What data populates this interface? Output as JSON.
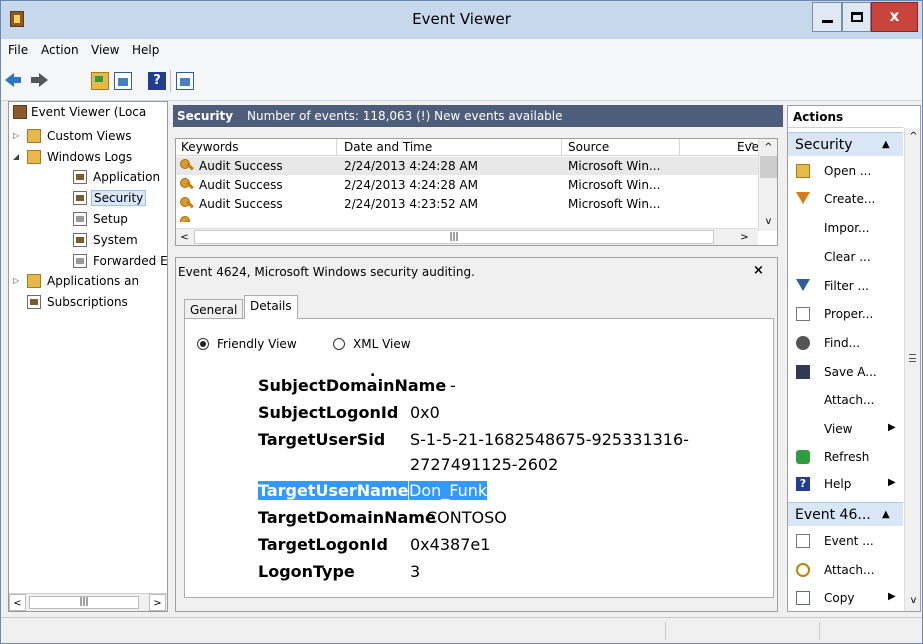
{
  "window": {
    "title": "Event Viewer"
  },
  "menu": [
    "File",
    "Action",
    "View",
    "Help"
  ],
  "tree": {
    "root": "Event Viewer (Loca",
    "custom_views": "Custom Views",
    "windows_logs": "Windows Logs",
    "application": "Application",
    "security": "Security",
    "setup": "Setup",
    "system": "System",
    "forwarded": "Forwarded E",
    "apps_services": "Applications an",
    "subscriptions": "Subscriptions"
  },
  "log_header": {
    "title": "Security",
    "info": "Number of events: 118,063 (!) New events available"
  },
  "events": {
    "columns": [
      "Keywords",
      "Date and Time",
      "Source",
      "Eve"
    ],
    "rows": [
      {
        "keywords": "Audit Success",
        "date": "2/24/2013 4:24:28 AM",
        "source": "Microsoft Win..."
      },
      {
        "keywords": "Audit Success",
        "date": "2/24/2013 4:24:28 AM",
        "source": "Microsoft Win..."
      },
      {
        "keywords": "Audit Success",
        "date": "2/24/2013 4:23:52 AM",
        "source": "Microsoft Win..."
      }
    ]
  },
  "details": {
    "title": "Event 4624, Microsoft Windows security auditing.",
    "close": "×",
    "tabs": [
      "General",
      "Details"
    ],
    "active_tab": "Details",
    "view_options": [
      "Friendly View",
      "XML View"
    ],
    "selected_view": "Friendly View",
    "fields": [
      {
        "key": "SubjectDomainName",
        "value": "-"
      },
      {
        "key": "SubjectLogonId",
        "value": "0x0"
      },
      {
        "key": "TargetUserSid",
        "value_line1": "S-1-5-21-1682548675-925331316-",
        "value_line2": "2727491125-2602"
      },
      {
        "key": "TargetUserName",
        "value": "Don_Funk",
        "highlighted": true
      },
      {
        "key": "TargetDomainName",
        "value": "CONTOSO"
      },
      {
        "key": "TargetLogonId",
        "value": "0x4387e1"
      },
      {
        "key": "LogonType",
        "value": "3"
      }
    ]
  },
  "actions": {
    "title": "Actions",
    "section1": "Security",
    "items1": [
      {
        "label": "Open ...",
        "icon": "folder-open-icon"
      },
      {
        "label": "Create...",
        "icon": "funnel-icon"
      },
      {
        "label": "Impor...",
        "icon": ""
      },
      {
        "label": "Clear ...",
        "icon": ""
      },
      {
        "label": "Filter ...",
        "icon": "filter-icon"
      },
      {
        "label": "Proper...",
        "icon": "properties-icon"
      },
      {
        "label": "Find...",
        "icon": "binoculars-icon"
      },
      {
        "label": "Save A...",
        "icon": "save-icon"
      },
      {
        "label": "Attach...",
        "icon": ""
      },
      {
        "label": "View",
        "icon": "",
        "submenu": true
      },
      {
        "label": "Refresh",
        "icon": "refresh-icon"
      },
      {
        "label": "Help",
        "icon": "help-icon",
        "submenu": true
      }
    ],
    "section2": "Event 46...",
    "items2": [
      {
        "label": "Event ...",
        "icon": "event-properties-icon"
      },
      {
        "label": "Attach...",
        "icon": "attach-task-icon"
      },
      {
        "label": "Copy",
        "icon": "copy-icon",
        "submenu": true
      }
    ]
  },
  "colors": {
    "titlebar": "#c7d7ec",
    "header": "#4e5e7a",
    "selection": "#3399ff",
    "close_button": "#c9443c",
    "action_section": "#d8e6f5"
  }
}
